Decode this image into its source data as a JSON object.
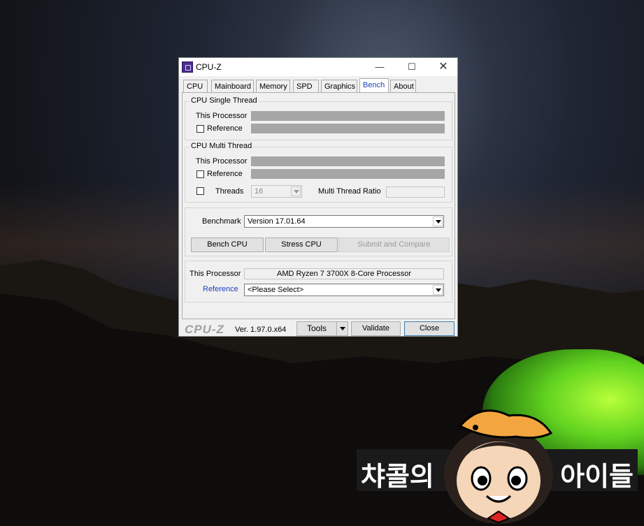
{
  "window": {
    "title": "CPU-Z",
    "minimize": "—",
    "maximize": "☐",
    "close": "✕"
  },
  "tabs": [
    "CPU",
    "Mainboard",
    "Memory",
    "SPD",
    "Graphics",
    "Bench",
    "About"
  ],
  "active_tab": "Bench",
  "single_thread": {
    "label": "CPU Single Thread",
    "this_processor": "This Processor",
    "reference": "Reference",
    "reference_checked": false
  },
  "multi_thread": {
    "label": "CPU Multi Thread",
    "this_processor": "This Processor",
    "reference": "Reference",
    "reference_checked": false,
    "threads_label": "Threads",
    "threads_value": "16",
    "ratio_label": "Multi Thread Ratio"
  },
  "benchmark": {
    "label": "Benchmark",
    "version": "Version 17.01.64",
    "bench_cpu": "Bench CPU",
    "stress_cpu": "Stress CPU",
    "submit": "Submit and Compare"
  },
  "compare": {
    "this_processor_label": "This Processor",
    "this_processor_value": "AMD Ryzen 7 3700X 8-Core Processor",
    "reference_label": "Reference",
    "reference_value": "<Please Select>"
  },
  "footer": {
    "logo": "CPU-Z",
    "version": "Ver. 1.97.0.x64",
    "tools": "Tools",
    "validate": "Validate",
    "close": "Close"
  },
  "watermark": {
    "left": "챠콜의",
    "right": "아이들"
  },
  "colors": {
    "link_blue": "#1a3fbf",
    "bar_gray": "#a6a6a6"
  }
}
